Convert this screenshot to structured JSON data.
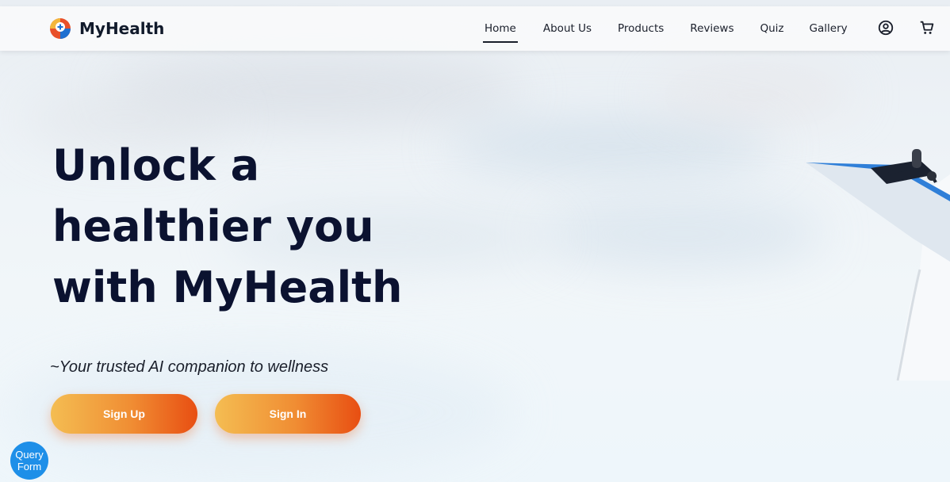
{
  "header": {
    "brand_name": "MyHealth",
    "nav": [
      {
        "label": "Home",
        "active": true
      },
      {
        "label": "About Us",
        "active": false
      },
      {
        "label": "Products",
        "active": false
      },
      {
        "label": "Reviews",
        "active": false
      },
      {
        "label": "Quiz",
        "active": false
      },
      {
        "label": "Gallery",
        "active": false
      }
    ],
    "icons": [
      "account-circle-icon",
      "shopping-cart-icon"
    ]
  },
  "hero": {
    "title_lines": [
      "Unlock a",
      "healthier you",
      "with MyHealth"
    ],
    "tagline": "~Your trusted AI companion to wellness",
    "buttons": {
      "sign_up": "Sign Up",
      "sign_in": "Sign In"
    }
  },
  "query_form": {
    "label": "Query Form"
  },
  "colors": {
    "title": "#0b1230",
    "button_gradient_start": "#f4bd52",
    "button_gradient_end": "#e84e12",
    "query_form_bg": "#1e8fe8"
  }
}
